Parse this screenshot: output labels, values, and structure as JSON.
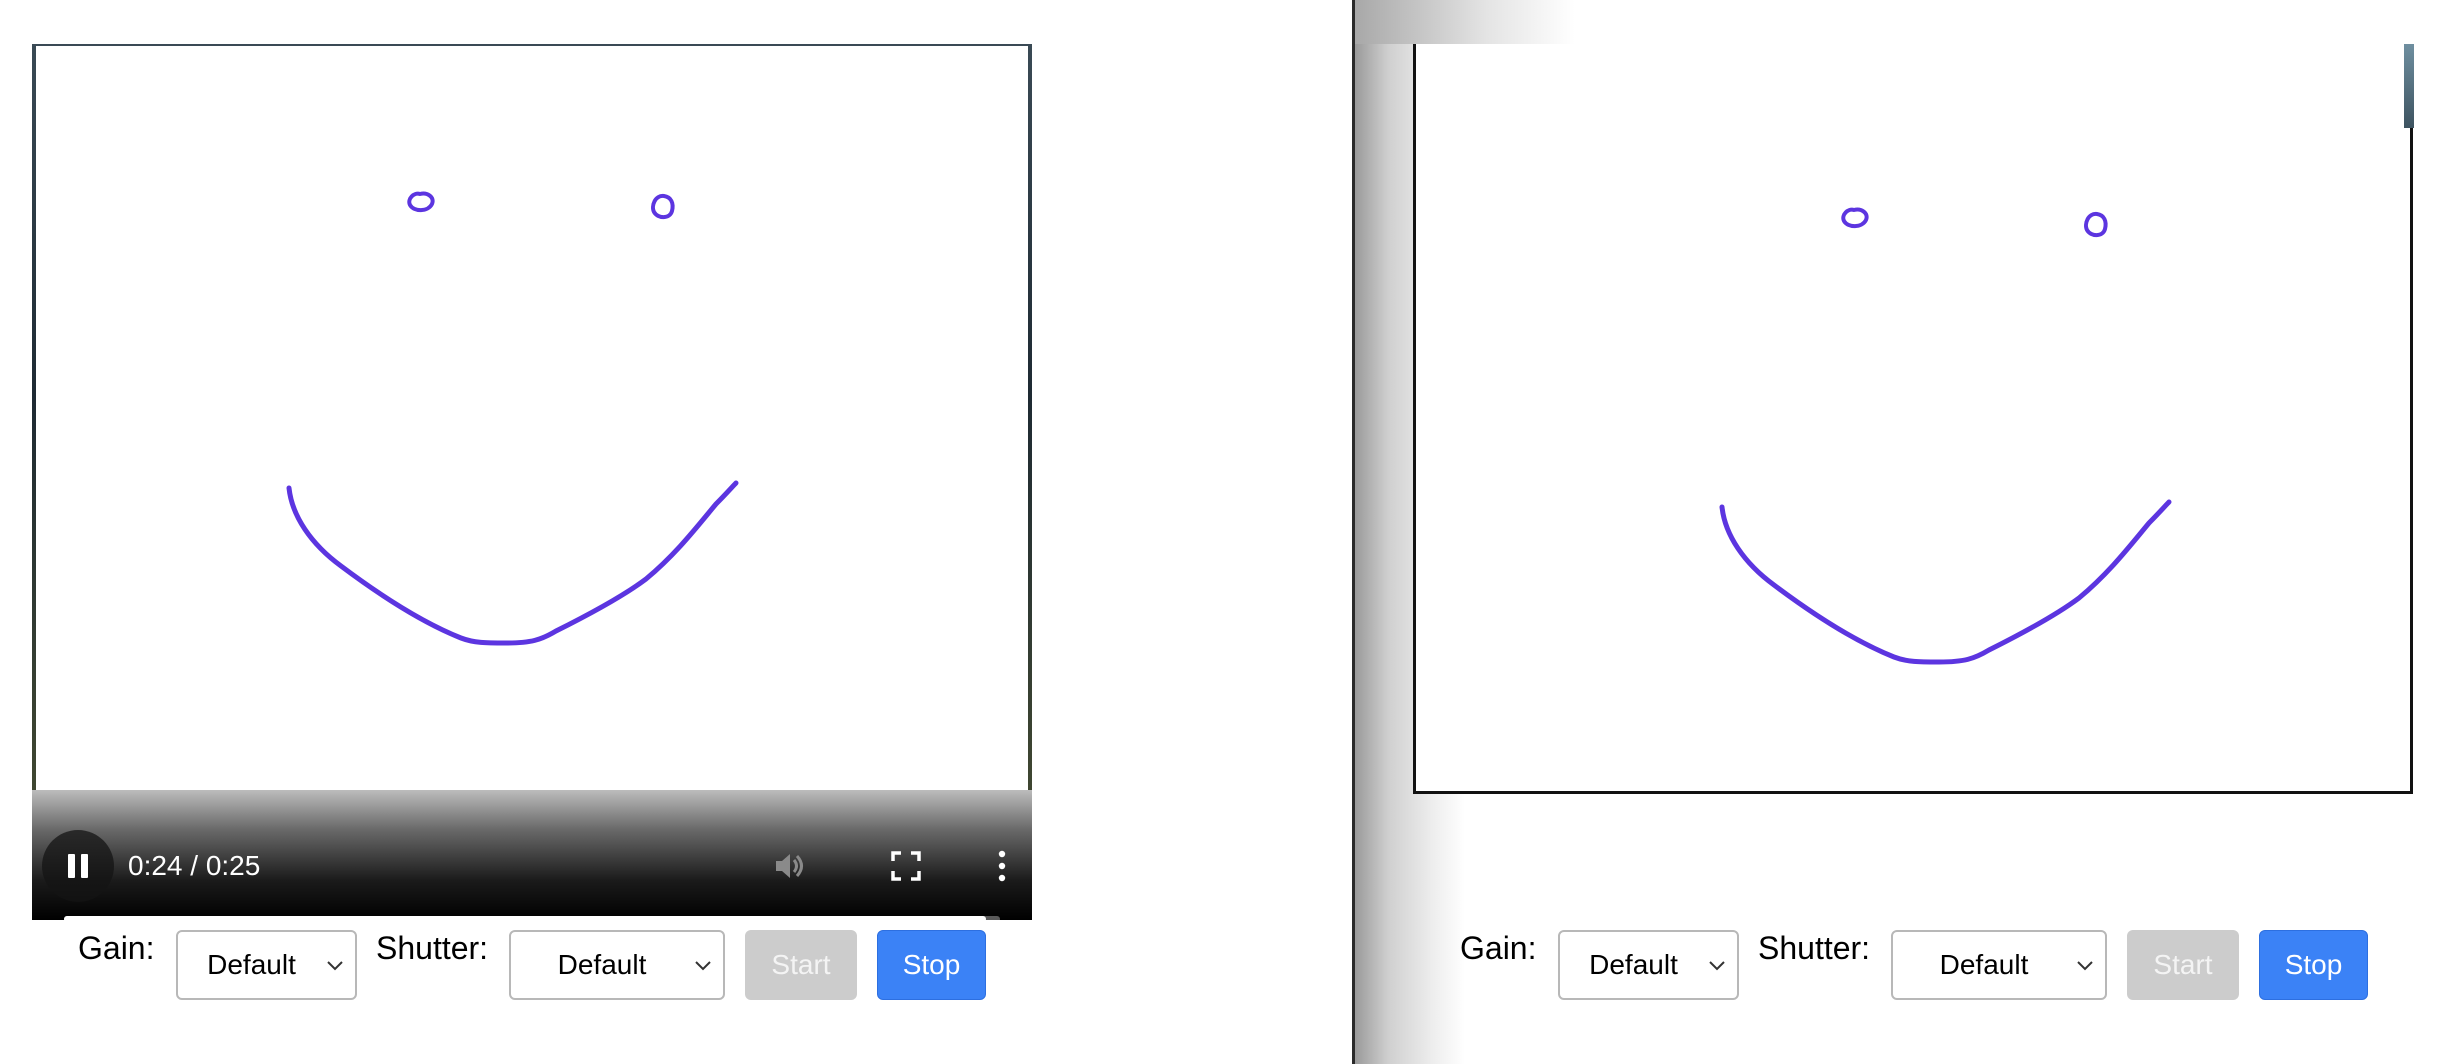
{
  "left": {
    "video": {
      "time_text": "0:24 / 0:25",
      "progress": 0.985,
      "icons": [
        "pause-icon",
        "volume-icon",
        "fullscreen-icon",
        "more-options-icon"
      ]
    },
    "toolbar": {
      "gain_label": "Gain:",
      "gain_value": "Default",
      "shutter_label": "Shutter:",
      "shutter_value": "Default",
      "start_label": "Start",
      "stop_label": "Stop"
    }
  },
  "right": {
    "toolbar": {
      "gain_label": "Gain:",
      "gain_value": "Default",
      "shutter_label": "Shutter:",
      "shutter_value": "Default",
      "start_label": "Start",
      "stop_label": "Stop"
    }
  },
  "colors": {
    "drawing_stroke": "#5c35e0",
    "primary_button": "#3b82f6",
    "disabled_button": "#cccccc"
  }
}
